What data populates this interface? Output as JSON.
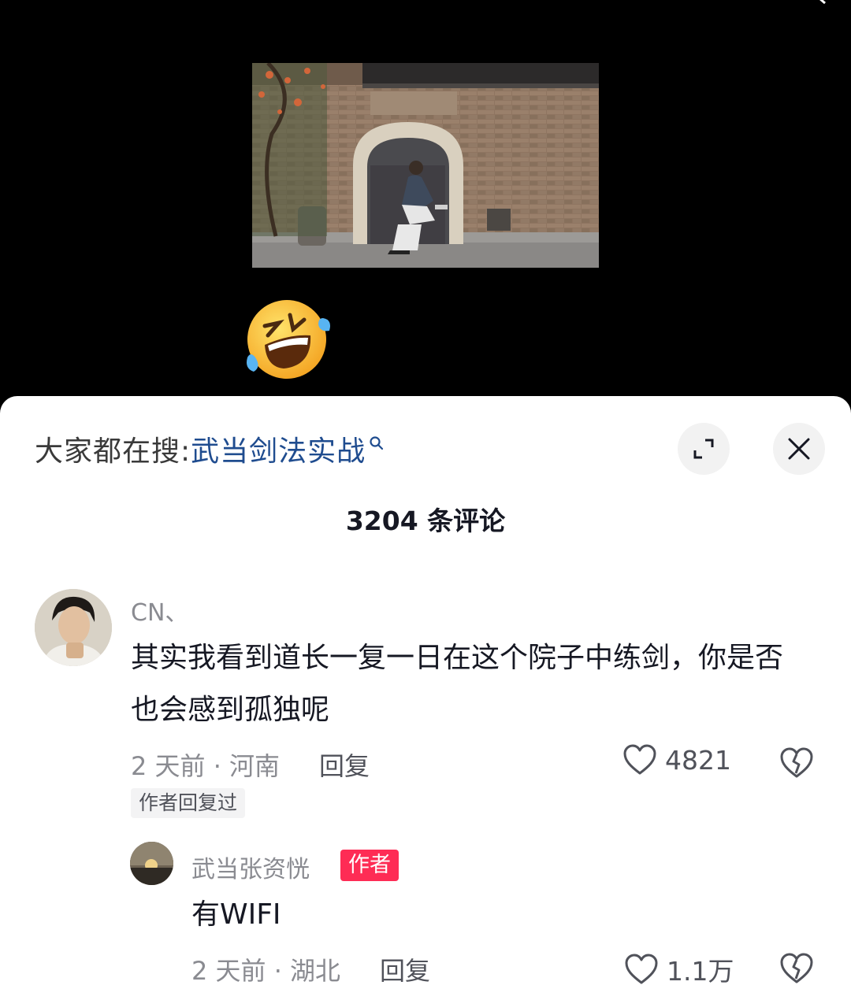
{
  "search": {
    "prefix": "大家都在搜:",
    "term": "武当剑法实战"
  },
  "comments_count_title": "3204 条评论",
  "comments": [
    {
      "username": "CN、",
      "text": "其实我看到道长一复一日在这个院子中练剑，你是否也会感到孤独呢",
      "meta": "2 天前 · 河南",
      "reply_label": "回复",
      "likes": "4821",
      "author_replied_tag": "作者回复过"
    }
  ],
  "reply": {
    "username": "武当张资恍",
    "badge": "作者",
    "text": "有WIFI",
    "meta": "2 天前 · 湖北",
    "reply_label": "回复",
    "likes": "1.1万"
  },
  "icons": {
    "expand": "expand-icon",
    "close": "close-icon",
    "like": "heart-outline-icon",
    "dislike": "broken-heart-icon",
    "search": "search-icon"
  },
  "colors": {
    "link_blue": "#1f4c8f",
    "author_badge": "#fe2c55",
    "meta_gray": "#8a8b91"
  }
}
